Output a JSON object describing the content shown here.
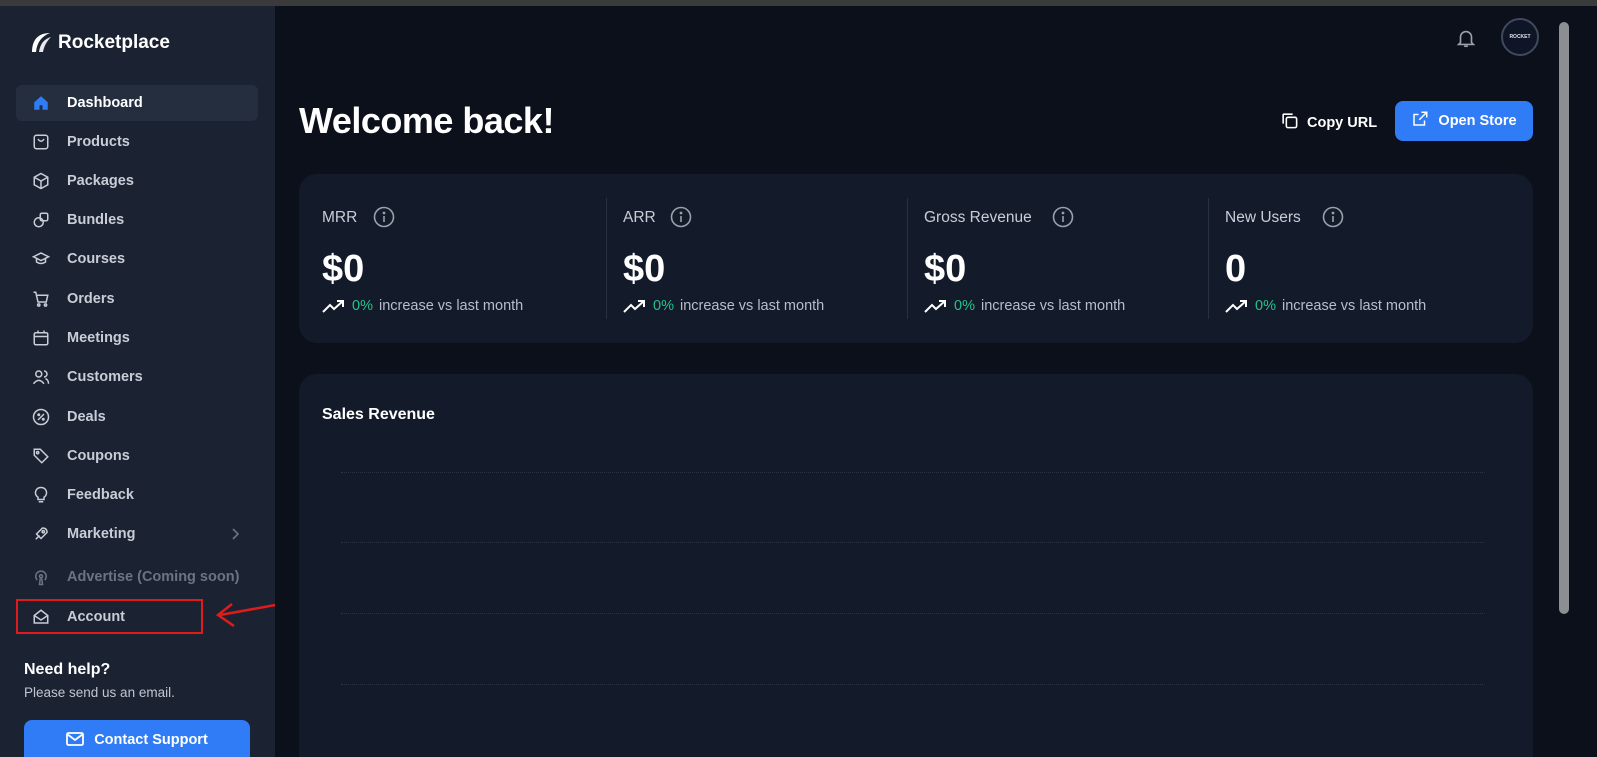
{
  "app": {
    "name": "Rocketplace"
  },
  "sidebar": {
    "items": [
      {
        "label": "Dashboard",
        "icon": "home-icon",
        "active": true
      },
      {
        "label": "Products",
        "icon": "shopping-bag-icon"
      },
      {
        "label": "Packages",
        "icon": "box-icon"
      },
      {
        "label": "Bundles",
        "icon": "bundle-icon"
      },
      {
        "label": "Courses",
        "icon": "graduation-cap-icon"
      },
      {
        "label": "Orders",
        "icon": "cart-icon"
      },
      {
        "label": "Meetings",
        "icon": "calendar-icon"
      },
      {
        "label": "Customers",
        "icon": "users-icon"
      },
      {
        "label": "Deals",
        "icon": "percent-icon"
      },
      {
        "label": "Coupons",
        "icon": "tag-icon"
      },
      {
        "label": "Feedback",
        "icon": "lightbulb-icon"
      },
      {
        "label": "Marketing",
        "icon": "rocket-icon",
        "has_submenu": true
      },
      {
        "label": "Advertise (Coming soon)",
        "icon": "podcast-icon",
        "disabled": true
      },
      {
        "label": "Account",
        "icon": "mail-open-icon"
      }
    ],
    "help": {
      "title": "Need help?",
      "subtitle": "Please send us an email.",
      "button_label": "Contact Support"
    }
  },
  "header": {
    "welcome": "Welcome back!",
    "copy_url_label": "Copy URL",
    "open_store_label": "Open Store",
    "avatar_text": "ROCKET"
  },
  "stats": [
    {
      "label": "MRR",
      "value": "$0",
      "pct": "0%",
      "trend_text": "increase vs last month"
    },
    {
      "label": "ARR",
      "value": "$0",
      "pct": "0%",
      "trend_text": "increase vs last month"
    },
    {
      "label": "Gross Revenue",
      "value": "$0",
      "pct": "0%",
      "trend_text": "increase vs last month"
    },
    {
      "label": "New Users",
      "value": "0",
      "pct": "0%",
      "trend_text": "increase vs last month"
    }
  ],
  "sales": {
    "title": "Sales Revenue"
  },
  "colors": {
    "accent": "#2f7cf6",
    "positive": "#25c28a",
    "annotation": "#e01b1b"
  }
}
